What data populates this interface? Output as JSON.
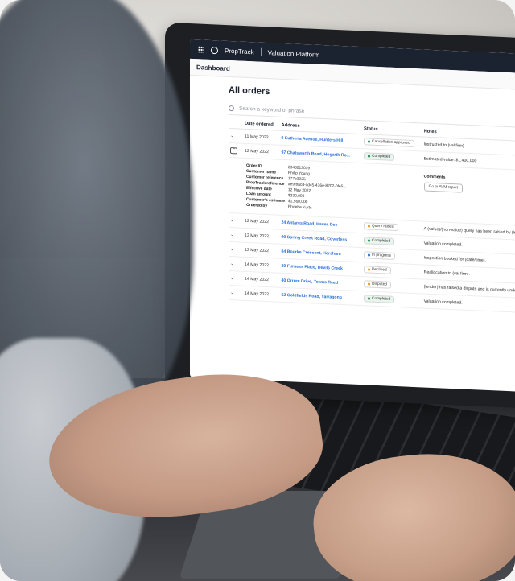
{
  "app": {
    "brand": "PropTrack",
    "product": "Valuation Platform",
    "breadcrumb": "Dashboard"
  },
  "orders": {
    "title": "All orders",
    "search_placeholder": "Search a keyword or phrase",
    "columns": [
      "Date ordered",
      "Address",
      "Status",
      "Notes"
    ],
    "rows": [
      {
        "date": "11 May 2022",
        "address": "9 Eutheria Avenue, Hunters Hill",
        "status": "Cancellation approved",
        "status_color": "#2a8a57",
        "notes": "Instructed to (val firm)"
      },
      {
        "date": "12 May 2022",
        "address": "97 Chatsworth Road, Hogarth Ro...",
        "status": "Completed",
        "status_color": "#2a8a57",
        "notes": "Estimated value: $1,400,000"
      },
      {
        "date": "12 May 2022",
        "address": "24 Antares Road, Haves Dee",
        "status": "Query raised",
        "status_color": "#e0a11b",
        "notes": "A (value)/(non-value) query has been raised by (lender)."
      },
      {
        "date": "13 May 2022",
        "address": "99 Spring Creek Road, Coverless",
        "status": "Completed",
        "status_color": "#2a8a57",
        "notes": "Valuation completed."
      },
      {
        "date": "13 May 2022",
        "address": "84 Bourke Crescent, Horsham",
        "status": "In progress",
        "status_color": "#2a6fdb",
        "notes": "Inspection booked for (date/time)."
      },
      {
        "date": "14 May 2022",
        "address": "39 Furness Place, Devils Creek",
        "status": "Declined",
        "status_color": "#e0a11b",
        "notes": "Reallocation to (val firm)."
      },
      {
        "date": "14 May 2022",
        "address": "40 Orrum Drive, Towns Reed",
        "status": "Disputed",
        "status_color": "#e0a11b",
        "notes": "(lender) has raised a dispute and is currently under review by (ptns)."
      },
      {
        "date": "14 May 2022",
        "address": "52 Goldfields Road, Yarragong",
        "status": "Completed",
        "status_color": "#2a8a57",
        "notes": "Valuation completed."
      }
    ],
    "detail": {
      "fields": [
        {
          "key": "Order ID",
          "value": "2348213039"
        },
        {
          "key": "Customer name",
          "value": "Philip Young"
        },
        {
          "key": "Customer reference",
          "value": "177b3925"
        },
        {
          "key": "PropTrack reference",
          "value": "ae9fbacd-cd45-436e-8202-0fe5..."
        },
        {
          "key": "Effective date",
          "value": "12 May 2022"
        },
        {
          "key": "Loan amount",
          "value": "$230,000"
        },
        {
          "key": "Customer's estimate",
          "value": "$1,560,000"
        },
        {
          "key": "Ordered by",
          "value": "Phoebe Kurts"
        }
      ],
      "comments_label": "Comments",
      "avm_button": "Go to AVM report"
    }
  }
}
